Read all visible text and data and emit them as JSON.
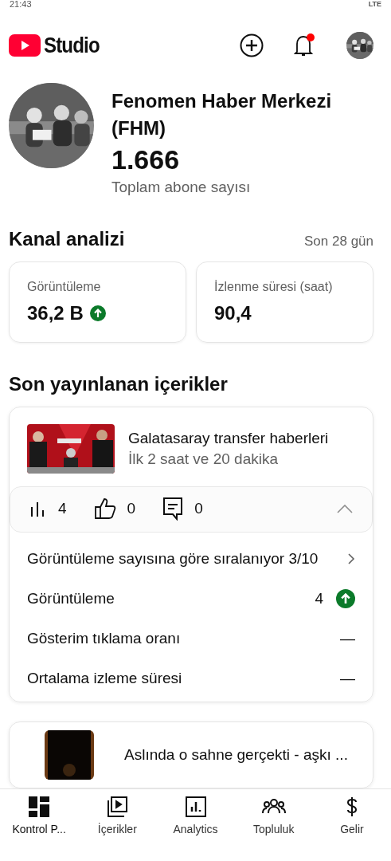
{
  "status_bar": {
    "time": "21:43",
    "network": "LTE"
  },
  "app_bar": {
    "logo_text": "Studio",
    "notification_dot": true
  },
  "channel": {
    "name": "Fenomen Haber Merkezi (FHM)",
    "subscribers": "1.666",
    "subscribers_label": "Toplam abone sayısı"
  },
  "analytics": {
    "title": "Kanal analizi",
    "period": "Son 28 gün",
    "metrics": [
      {
        "label": "Görüntüleme",
        "value": "36,2 B",
        "rising": true
      },
      {
        "label": "İzlenme süresi (saat)",
        "value": "90,4",
        "rising": false
      }
    ]
  },
  "recent": {
    "title": "Son yayınlanan içerikler",
    "videos": [
      {
        "title": "Galatasaray  transfer haberleri",
        "subtitle": "İlk 2 saat ve 20 dakika",
        "views": "4",
        "likes": "0",
        "comments": "0",
        "expanded": true,
        "details": [
          {
            "kind": "link",
            "label": "Görüntüleme sayısına göre sıralanıyor 3/10"
          },
          {
            "kind": "value",
            "label": "Görüntüleme",
            "value": "4",
            "rising": true
          },
          {
            "kind": "value",
            "label": "Gösterim tıklama oranı",
            "value": "—",
            "rising": false
          },
          {
            "kind": "value",
            "label": "Ortalama izleme süresi",
            "value": "—",
            "rising": false
          }
        ]
      },
      {
        "title": "Aslında o sahne gerçekti - aşkı ..."
      }
    ]
  },
  "nav": [
    {
      "label": "Kontrol P...",
      "selected": true
    },
    {
      "label": "İçerikler",
      "selected": false
    },
    {
      "label": "Analytics",
      "selected": false
    },
    {
      "label": "Topluluk",
      "selected": false
    },
    {
      "label": "Gelir",
      "selected": false
    }
  ]
}
